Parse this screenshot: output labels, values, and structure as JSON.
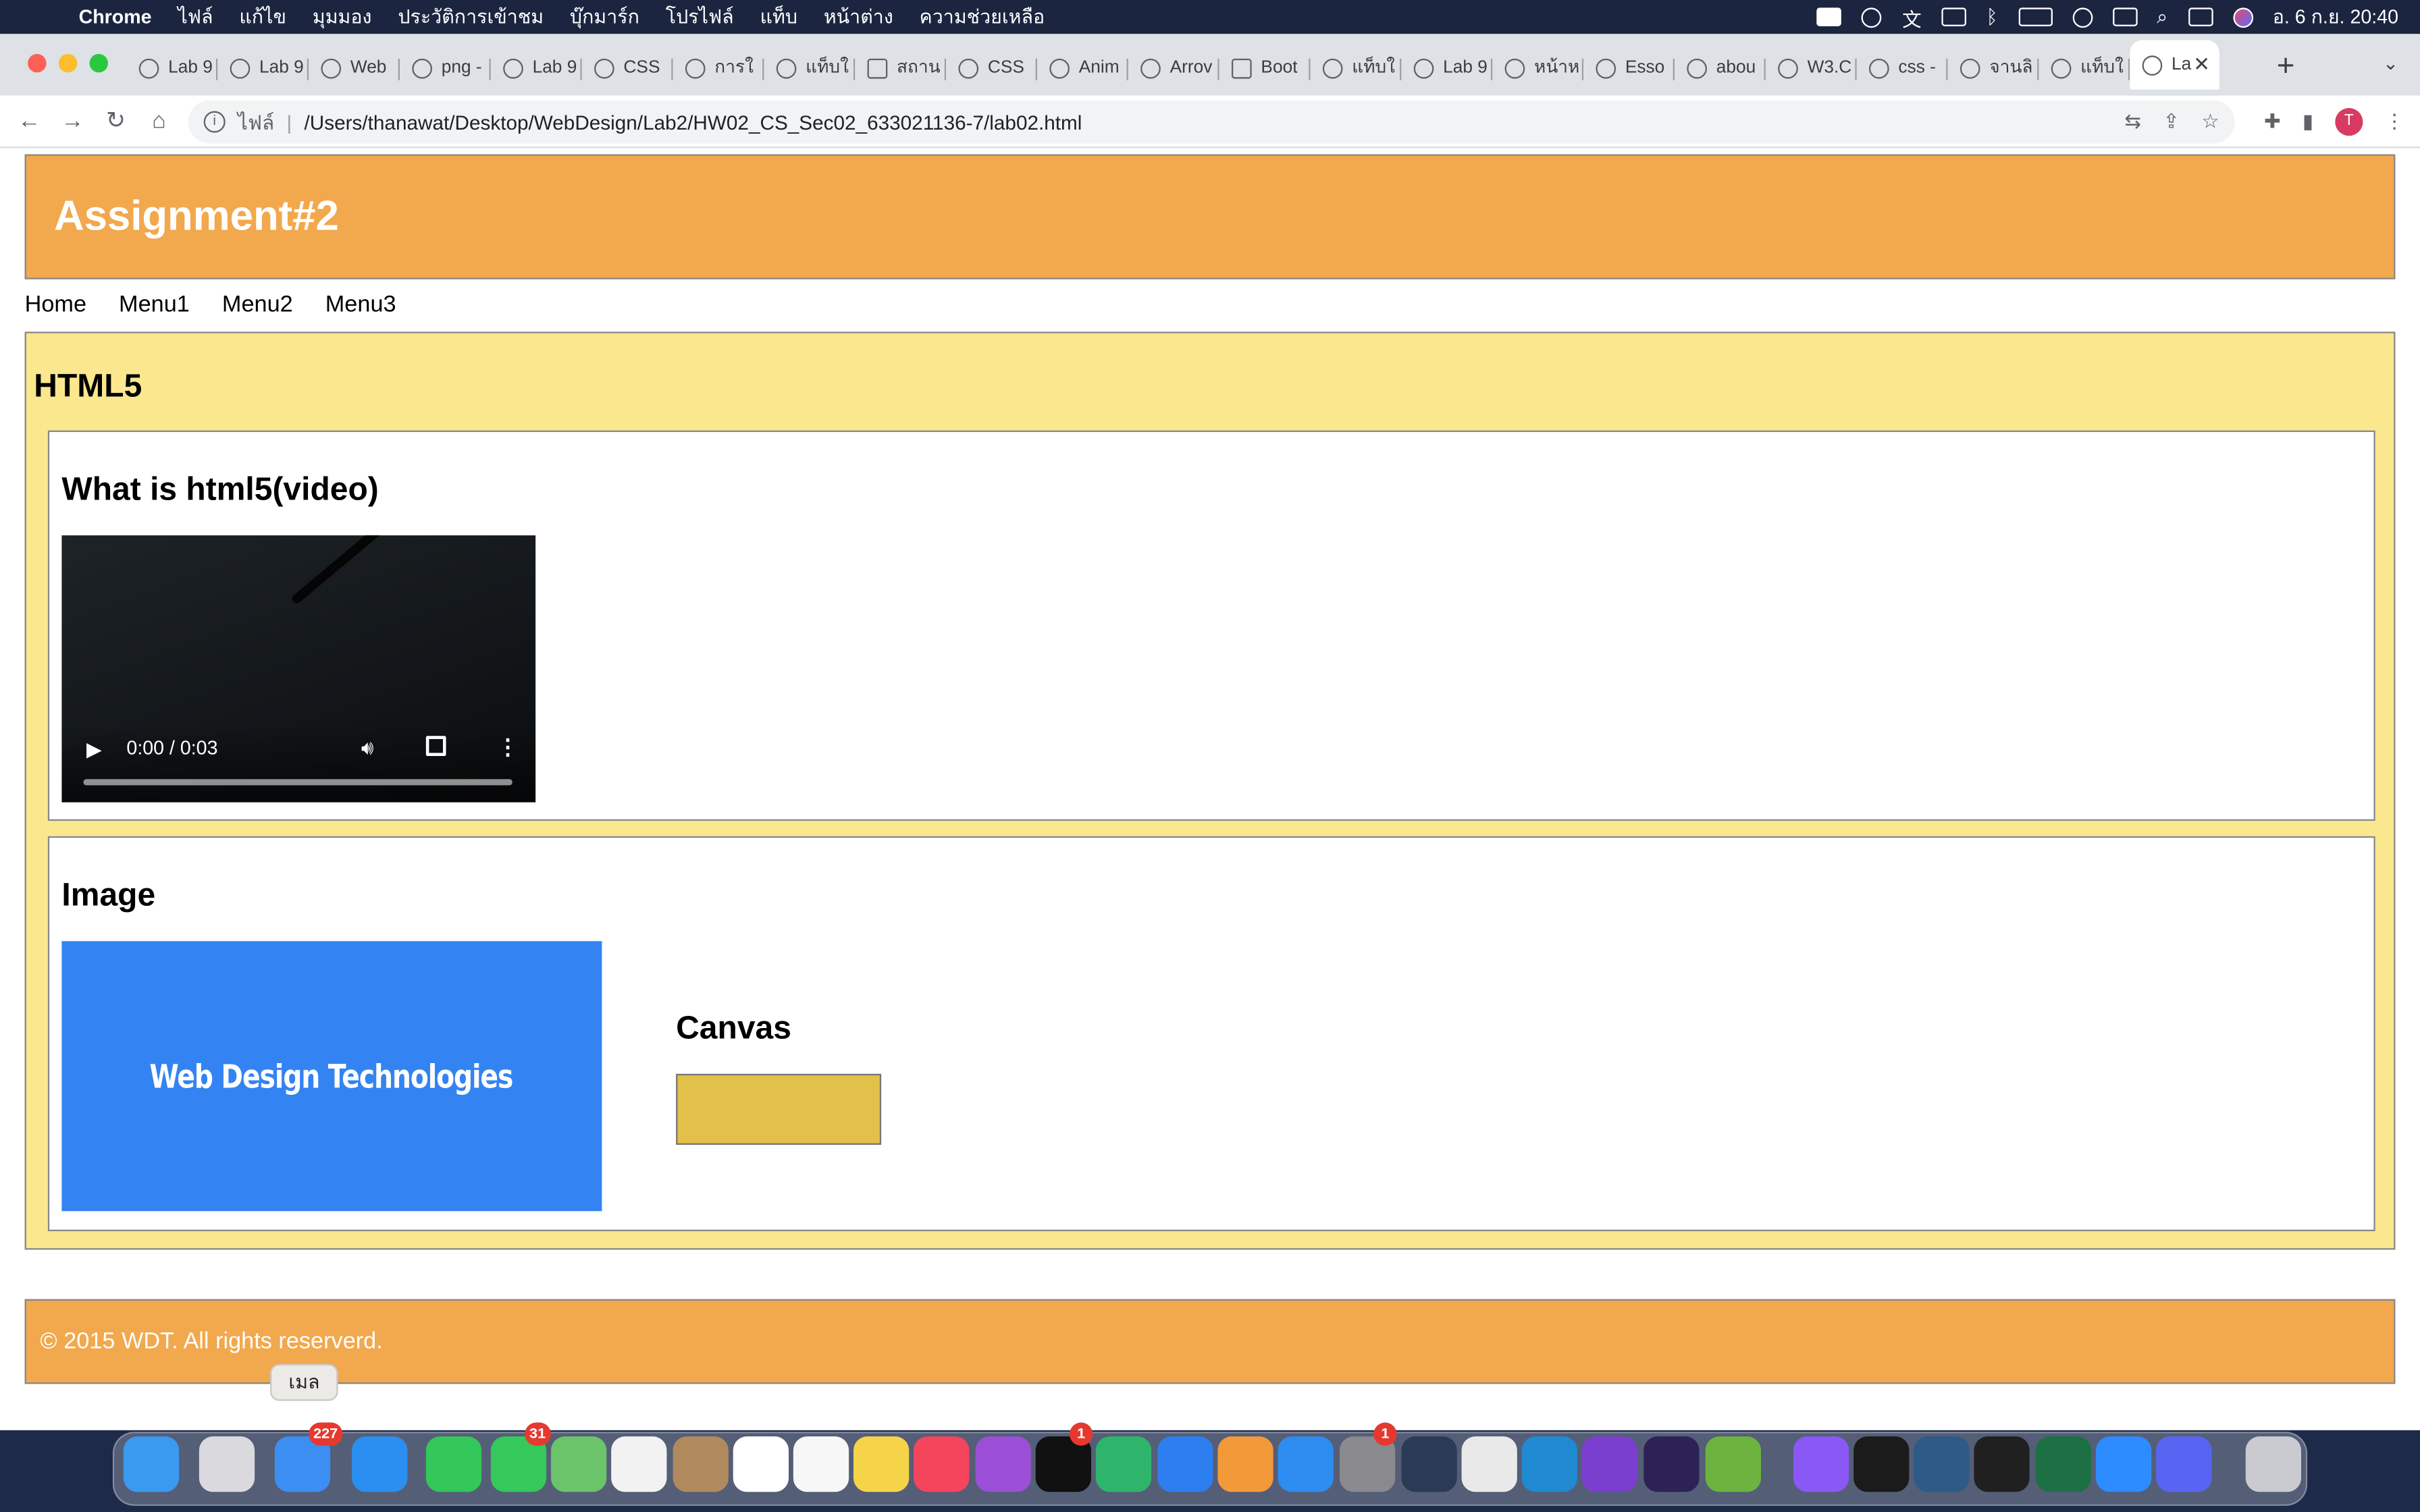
{
  "menubar": {
    "app_name": "Chrome",
    "menus": [
      "ไฟล์",
      "แก้ไข",
      "มุมมอง",
      "ประวัติการเข้าชม",
      "บุ๊กมาร์ก",
      "โปรไฟล์",
      "แท็บ",
      "หน้าต่าง",
      "ความช่วยเหลือ"
    ],
    "clock": "อ. 6 ก.ย.  20:40",
    "status_icons": [
      "video-icon",
      "creative-cloud-icon",
      "translate-icon",
      "input-a-icon",
      "bluetooth-icon",
      "battery-icon",
      "link-icon",
      "keyboard-icon",
      "search-icon",
      "control-center-icon",
      "siri-icon"
    ]
  },
  "browser": {
    "tabs": [
      {
        "label": "Lab 9",
        "icon": "globe-icon"
      },
      {
        "label": "Lab 9",
        "icon": "globe-icon"
      },
      {
        "label": "Web",
        "icon": "v-icon"
      },
      {
        "label": "png -",
        "icon": "stack-icon"
      },
      {
        "label": "Lab 9",
        "icon": "globe-icon"
      },
      {
        "label": "CSS",
        "icon": "w3-icon"
      },
      {
        "label": "การใ",
        "icon": "mountain-icon"
      },
      {
        "label": "แท็บใ",
        "icon": "chrome-icon"
      },
      {
        "label": "สถาน",
        "icon": "sheets-icon"
      },
      {
        "label": "CSS",
        "icon": "w3-icon"
      },
      {
        "label": "Anim",
        "icon": "anim-icon"
      },
      {
        "label": "Arrov",
        "icon": "c-icon"
      },
      {
        "label": "Boot",
        "icon": "bootstrap-icon"
      },
      {
        "label": "แท็บใ",
        "icon": "chrome-icon"
      },
      {
        "label": "Lab 9",
        "icon": "globe-icon"
      },
      {
        "label": "หน้าห",
        "icon": "c-icon"
      },
      {
        "label": "Esso",
        "icon": "c-icon"
      },
      {
        "label": "abou",
        "icon": "google-icon"
      },
      {
        "label": "W3.C",
        "icon": "w3-icon"
      },
      {
        "label": "css -",
        "icon": "stack-icon"
      },
      {
        "label": "จานลิ",
        "icon": "cup-icon"
      },
      {
        "label": "แท็บใ",
        "icon": "chrome-icon"
      },
      {
        "label": "La",
        "icon": "globe-icon",
        "active": true
      }
    ],
    "new_tab": "+",
    "tab_close": "✕",
    "url_scheme": "ไฟล์",
    "url_path": "/Users/thanawat/Desktop/WebDesign/Lab2/HW02_CS_Sec02_633021136-7/lab02.html",
    "profile_initial": "T"
  },
  "page": {
    "header_title": "Assignment#2",
    "nav": [
      "Home",
      "Menu1",
      "Menu2",
      "Menu3"
    ],
    "section_title": "HTML5",
    "video_article": {
      "title": "What is html5(video)",
      "time": "0:00 / 0:03"
    },
    "image_article": {
      "title": "Image",
      "image_text": "Web Design Technologies",
      "canvas_title": "Canvas"
    },
    "footer_text": "© 2015 WDT. All rights reserverd.",
    "colors": {
      "header_bg": "#f2a84c",
      "section_bg": "#fae78e",
      "image_bg": "#3384f2",
      "canvas_fill": "#e2c049"
    }
  },
  "dock": {
    "tooltip": "เมล",
    "apps": [
      {
        "name": "finder-icon",
        "color": "#3a9af0"
      },
      {
        "name": "launchpad-icon",
        "color": "#d9d9de"
      },
      {
        "name": "mail-icon",
        "color": "#3d8ef2",
        "badge": "227"
      },
      {
        "name": "safari-icon",
        "color": "#2a8ff0"
      },
      {
        "name": "facetime-icon",
        "color": "#34c759"
      },
      {
        "name": "messages-icon",
        "color": "#35c85a",
        "badge": "31"
      },
      {
        "name": "maps-icon",
        "color": "#6bc36a"
      },
      {
        "name": "photos-icon",
        "color": "#f2f2f2"
      },
      {
        "name": "contacts-icon",
        "color": "#b08a5c"
      },
      {
        "name": "calendar-icon",
        "color": "#ffffff"
      },
      {
        "name": "reminders-icon",
        "color": "#f7f7f7"
      },
      {
        "name": "notes-icon",
        "color": "#f6d44a"
      },
      {
        "name": "music-icon",
        "color": "#f5455c"
      },
      {
        "name": "podcasts-icon",
        "color": "#9b4fd6"
      },
      {
        "name": "tv-icon",
        "color": "#111111",
        "badge": "1"
      },
      {
        "name": "numbers-icon",
        "color": "#2fb46b"
      },
      {
        "name": "keynote-icon",
        "color": "#2d7ff0"
      },
      {
        "name": "pages-icon",
        "color": "#f29a3a"
      },
      {
        "name": "app-store-icon",
        "color": "#2d8cf0"
      },
      {
        "name": "system-preferences-icon",
        "color": "#8a8a8e",
        "badge": "1"
      },
      {
        "name": "quicktime-icon",
        "color": "#2b3a55"
      },
      {
        "name": "chrome-icon",
        "color": "#e9e9e9"
      },
      {
        "name": "vscode-icon",
        "color": "#1f8ad2"
      },
      {
        "name": "visual-studio-icon",
        "color": "#7b3fd0"
      },
      {
        "name": "eclipse-icon",
        "color": "#2c2255"
      },
      {
        "name": "spring-icon",
        "color": "#6db33f"
      },
      {
        "name": "messenger-icon",
        "color": "#8a58f5"
      },
      {
        "name": "terminal-icon",
        "color": "#1b1b1b"
      },
      {
        "name": "mysql-workbench-icon",
        "color": "#2d5a86"
      },
      {
        "name": "terminal-2-icon",
        "color": "#202020"
      },
      {
        "name": "excel-icon",
        "color": "#1d7044"
      },
      {
        "name": "zoom-icon",
        "color": "#2d8cff"
      },
      {
        "name": "discord-icon",
        "color": "#5865f2"
      },
      {
        "name": "trash-icon",
        "color": "#c9cbd1"
      }
    ]
  }
}
